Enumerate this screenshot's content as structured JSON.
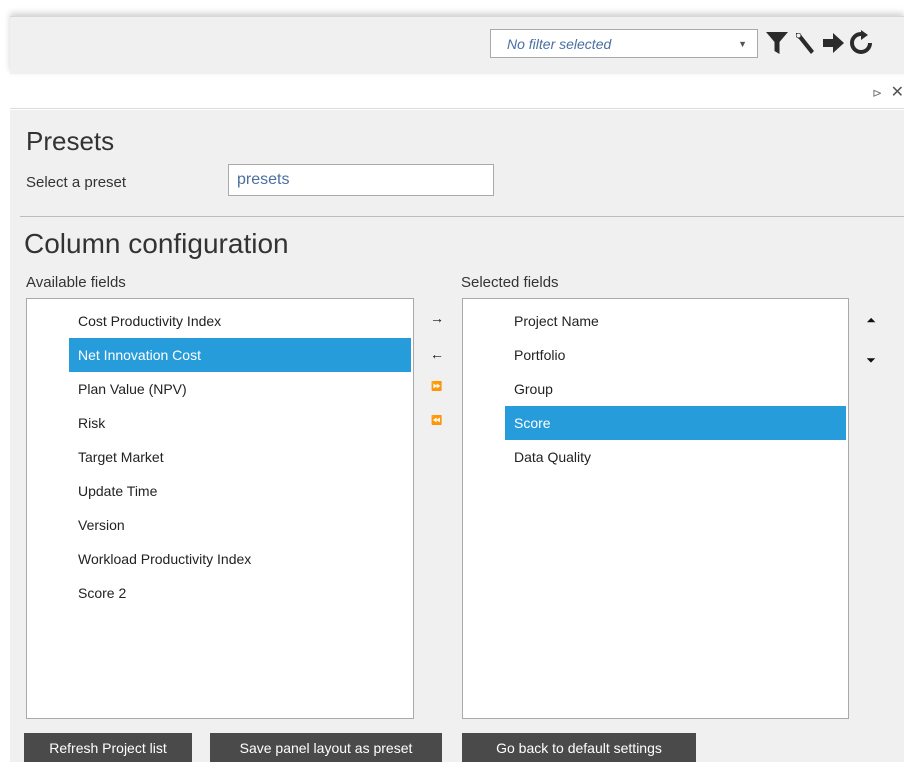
{
  "toolbar": {
    "filter_value": "No filter selected",
    "icons": [
      "filter-icon",
      "wrench-icon",
      "arrow-right-icon",
      "refresh-icon"
    ]
  },
  "panel": {
    "pin_glyph": "⊳",
    "close_glyph": "✕"
  },
  "presets": {
    "heading": "Presets",
    "select_label": "Select a preset",
    "input_value": "presets"
  },
  "columns": {
    "heading": "Column configuration",
    "available_label": "Available fields",
    "selected_label": "Selected fields",
    "available": [
      {
        "label": "Cost Productivity Index",
        "selected": false
      },
      {
        "label": "Net Innovation Cost",
        "selected": true
      },
      {
        "label": "Plan Value (NPV)",
        "selected": false
      },
      {
        "label": "Risk",
        "selected": false
      },
      {
        "label": "Target Market",
        "selected": false
      },
      {
        "label": "Update Time",
        "selected": false
      },
      {
        "label": "Version",
        "selected": false
      },
      {
        "label": "Workload Productivity Index",
        "selected": false
      },
      {
        "label": "Score 2",
        "selected": false
      }
    ],
    "selected": [
      {
        "label": "Project Name",
        "selected": false
      },
      {
        "label": "Portfolio",
        "selected": false
      },
      {
        "label": "Group",
        "selected": false
      },
      {
        "label": "Score",
        "selected": true
      },
      {
        "label": "Data Quality",
        "selected": false
      }
    ],
    "move_glyphs": {
      "add": "→",
      "remove": "←",
      "add_all": "⏩",
      "remove_all": "⏪"
    },
    "order_glyphs": {
      "up": "⏶",
      "down": "⏷"
    }
  },
  "actions": {
    "refresh": "Refresh Project list",
    "save_preset": "Save panel layout as preset",
    "reset": "Go back to default settings"
  },
  "colors": {
    "accent": "#279cda",
    "button_dark": "#4a4a4a",
    "background": "#f0f0f0",
    "input_text": "#4a6fa0"
  }
}
